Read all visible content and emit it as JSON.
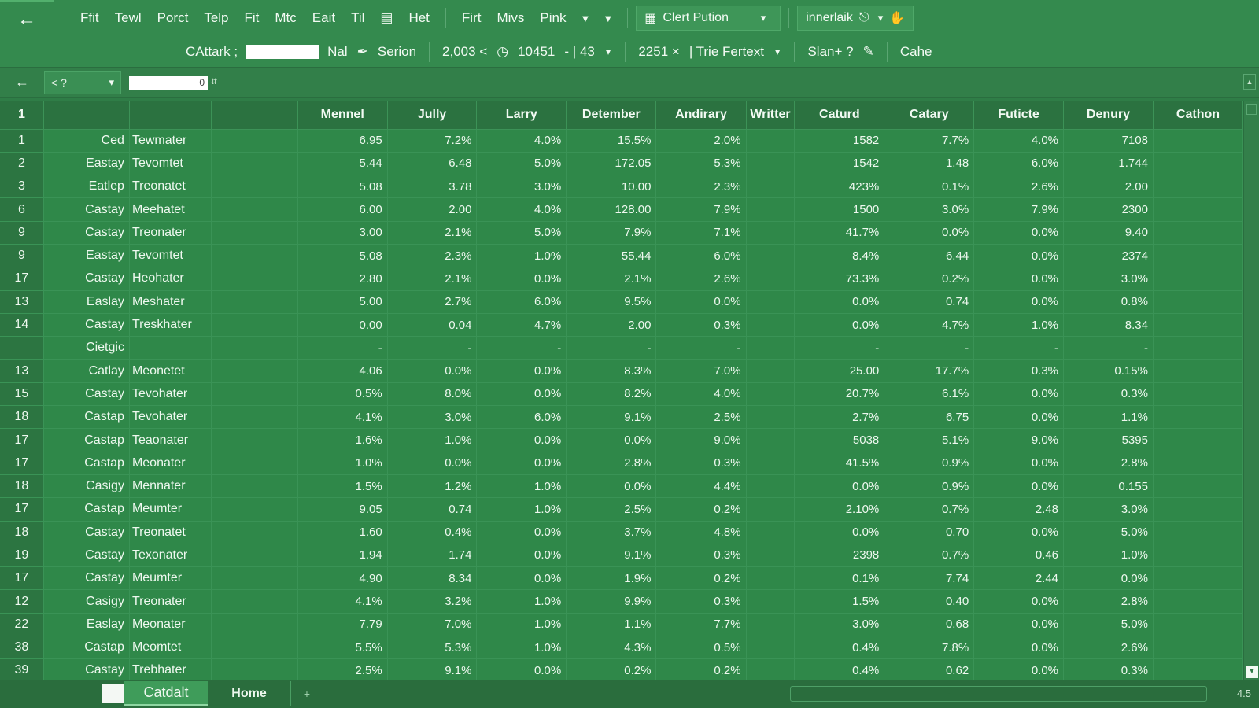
{
  "menu": {
    "items": [
      "Ffit",
      "Tewl",
      "Porct",
      "Telp",
      "Fit",
      "Mtc",
      "Eait",
      "Til"
    ],
    "after_icon": "Het",
    "items2": [
      "Firt",
      "Mivs",
      "Pink"
    ],
    "chart_box": "Clert Pution",
    "right_box": "innerlaik"
  },
  "toolbar": {
    "label1": "CAttark ;",
    "label2": "Nal",
    "label3": "Serion",
    "num1": "2,003 <",
    "num2": "10451",
    "num3": "- | 43",
    "num4": "2251 ×",
    "font_box": "| Trie Fertext",
    "share": "Slan+ ?",
    "cache": "Cahe"
  },
  "formula": {
    "namebox": "< ?",
    "value": "0"
  },
  "grid": {
    "corner": "1",
    "headers": [
      "Mennel",
      "Jully",
      "Larry",
      "Detember",
      "Andirary",
      "Writter",
      "Caturd",
      "Catary",
      "Futicte",
      "Denury",
      "Cathon"
    ],
    "rows": [
      {
        "n": "1",
        "a": "Ced",
        "b": "Tewmater",
        "v": [
          "6.95",
          "7.2%",
          "4.0%",
          "15.5%",
          "2.0%",
          "",
          "1582",
          "7.7%",
          "4.0%",
          "7108",
          ""
        ]
      },
      {
        "n": "2",
        "a": "Eastay",
        "b": "Tevomtet",
        "v": [
          "5.44",
          "6.48",
          "5.0%",
          "172.05",
          "5.3%",
          "",
          "1542",
          "1.48",
          "6.0%",
          "1.744",
          ""
        ]
      },
      {
        "n": "3",
        "a": "Eatlep",
        "b": "Treonatet",
        "v": [
          "5.08",
          "3.78",
          "3.0%",
          "10.00",
          "2.3%",
          "",
          "423%",
          "0.1%",
          "2.6%",
          "2.00",
          ""
        ]
      },
      {
        "n": "6",
        "a": "Castay",
        "b": "Meehatet",
        "v": [
          "6.00",
          "2.00",
          "4.0%",
          "128.00",
          "7.9%",
          "",
          "1500",
          "3.0%",
          "7.9%",
          "2300",
          ""
        ]
      },
      {
        "n": "9",
        "a": "Castay",
        "b": "Treonater",
        "v": [
          "3.00",
          "2.1%",
          "5.0%",
          "7.9%",
          "7.1%",
          "",
          "41.7%",
          "0.0%",
          "0.0%",
          "9.40",
          ""
        ]
      },
      {
        "n": "9",
        "a": "Eastay",
        "b": "Tevomtet",
        "v": [
          "5.08",
          "2.3%",
          "1.0%",
          "55.44",
          "6.0%",
          "",
          "8.4%",
          "6.44",
          "0.0%",
          "2374",
          ""
        ]
      },
      {
        "n": "17",
        "a": "Castay",
        "b": "Heohater",
        "v": [
          "2.80",
          "2.1%",
          "0.0%",
          "2.1%",
          "2.6%",
          "",
          "73.3%",
          "0.2%",
          "0.0%",
          "3.0%",
          ""
        ]
      },
      {
        "n": "13",
        "a": "Easlay",
        "b": "Meshater",
        "v": [
          "5.00",
          "2.7%",
          "6.0%",
          "9.5%",
          "0.0%",
          "",
          "0.0%",
          "0.74",
          "0.0%",
          "0.8%",
          ""
        ]
      },
      {
        "n": "14",
        "a": "Castay",
        "b": "Treskhater",
        "v": [
          "0.00",
          "0.04",
          "4.7%",
          "2.00",
          "0.3%",
          "",
          "0.0%",
          "4.7%",
          "1.0%",
          "8.34",
          ""
        ]
      },
      {
        "n": "",
        "a": "Cietgic",
        "b": "",
        "v": [
          "-",
          "-",
          "-",
          "-",
          "-",
          "",
          "-",
          "-",
          "-",
          "-",
          ""
        ]
      },
      {
        "n": "13",
        "a": "Catlay",
        "b": "Meonetet",
        "v": [
          "4.06",
          "0.0%",
          "0.0%",
          "8.3%",
          "7.0%",
          "",
          "25.00",
          "17.7%",
          "0.3%",
          "0.15%",
          ""
        ]
      },
      {
        "n": "15",
        "a": "Castay",
        "b": "Tevohater",
        "v": [
          "0.5%",
          "8.0%",
          "0.0%",
          "8.2%",
          "4.0%",
          "",
          "20.7%",
          "6.1%",
          "0.0%",
          "0.3%",
          ""
        ]
      },
      {
        "n": "18",
        "a": "Castap",
        "b": "Tevohater",
        "v": [
          "4.1%",
          "3.0%",
          "6.0%",
          "9.1%",
          "2.5%",
          "",
          "2.7%",
          "6.75",
          "0.0%",
          "1.1%",
          ""
        ]
      },
      {
        "n": "17",
        "a": "Castap",
        "b": "Teaonater",
        "v": [
          "1.6%",
          "1.0%",
          "0.0%",
          "0.0%",
          "9.0%",
          "",
          "5038",
          "5.1%",
          "9.0%",
          "5395",
          ""
        ]
      },
      {
        "n": "17",
        "a": "Castap",
        "b": "Meonater",
        "v": [
          "1.0%",
          "0.0%",
          "0.0%",
          "2.8%",
          "0.3%",
          "",
          "41.5%",
          "0.9%",
          "0.0%",
          "2.8%",
          ""
        ]
      },
      {
        "n": "18",
        "a": "Casigy",
        "b": "Mennater",
        "v": [
          "1.5%",
          "1.2%",
          "1.0%",
          "0.0%",
          "4.4%",
          "",
          "0.0%",
          "0.9%",
          "0.0%",
          "0.155",
          ""
        ]
      },
      {
        "n": "17",
        "a": "Castap",
        "b": "Meumter",
        "v": [
          "9.05",
          "0.74",
          "1.0%",
          "2.5%",
          "0.2%",
          "",
          "2.10%",
          "0.7%",
          "2.48",
          "3.0%",
          ""
        ]
      },
      {
        "n": "18",
        "a": "Castay",
        "b": "Treonatet",
        "v": [
          "1.60",
          "0.4%",
          "0.0%",
          "3.7%",
          "4.8%",
          "",
          "0.0%",
          "0.70",
          "0.0%",
          "5.0%",
          ""
        ]
      },
      {
        "n": "19",
        "a": "Castay",
        "b": "Texonater",
        "v": [
          "1.94",
          "1.74",
          "0.0%",
          "9.1%",
          "0.3%",
          "",
          "2398",
          "0.7%",
          "0.46",
          "1.0%",
          ""
        ]
      },
      {
        "n": "17",
        "a": "Castay",
        "b": "Meumter",
        "v": [
          "4.90",
          "8.34",
          "0.0%",
          "1.9%",
          "0.2%",
          "",
          "0.1%",
          "7.74",
          "2.44",
          "0.0%",
          ""
        ]
      },
      {
        "n": "12",
        "a": "Casigy",
        "b": "Treonater",
        "v": [
          "4.1%",
          "3.2%",
          "1.0%",
          "9.9%",
          "0.3%",
          "",
          "1.5%",
          "0.40",
          "0.0%",
          "2.8%",
          ""
        ]
      },
      {
        "n": "22",
        "a": "Easlay",
        "b": "Meonater",
        "v": [
          "7.79",
          "7.0%",
          "1.0%",
          "1.1%",
          "7.7%",
          "",
          "3.0%",
          "0.68",
          "0.0%",
          "5.0%",
          ""
        ]
      },
      {
        "n": "38",
        "a": "Castap",
        "b": "Meomtet",
        "v": [
          "5.5%",
          "5.3%",
          "1.0%",
          "4.3%",
          "0.5%",
          "",
          "0.4%",
          "7.8%",
          "0.0%",
          "2.6%",
          ""
        ]
      },
      {
        "n": "39",
        "a": "Castay",
        "b": "Trebhater",
        "v": [
          "2.5%",
          "9.1%",
          "0.0%",
          "0.2%",
          "0.2%",
          "",
          "0.4%",
          "0.62",
          "0.0%",
          "0.3%",
          ""
        ]
      }
    ]
  },
  "tabs": {
    "active": "Catdalt",
    "other": "Home",
    "add": "+"
  },
  "status": {
    "zoom": "4.5"
  },
  "colors": {
    "background": "#2f7d47",
    "header": "#2b7240",
    "active_tab": "#3f9c5a"
  }
}
